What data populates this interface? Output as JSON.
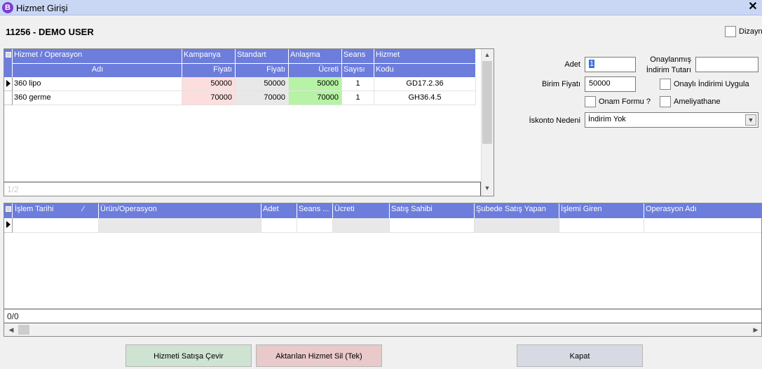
{
  "window": {
    "title": "Hizmet Girişi",
    "app_icon": "B",
    "close_glyph": "✕"
  },
  "customer": {
    "label": "11256  -  DEMO USER"
  },
  "dizayn_label": "Dizayn",
  "services_grid": {
    "headers_top": [
      "Hizmet / Operasyon",
      "Kampanya",
      "Standart",
      "Anlaşma",
      "Seans",
      "Hizmet"
    ],
    "headers_bottom": [
      "Adı",
      "Fiyatı",
      "Fiyatı",
      "Ücreti",
      "Sayısı",
      "Kodu"
    ],
    "rows": [
      {
        "name": "360 lipo",
        "kampanya": "50000",
        "standart": "50000",
        "anlasma": "50000",
        "seans": "1",
        "kod": "GD17.2.36"
      },
      {
        "name": "360 germe",
        "kampanya": "70000",
        "standart": "70000",
        "anlasma": "70000",
        "seans": "1",
        "kod": "GH36.4.5"
      }
    ],
    "footer": "1/2"
  },
  "form": {
    "adet_label": "Adet",
    "adet_value": "1",
    "onaylanmis_label_1": "Onaylanmış",
    "onaylanmis_label_2": "İndirim Tutarı",
    "onaylanmis_value": "",
    "birim_fiyati_label": "Birim Fiyatı",
    "birim_fiyati_value": "50000",
    "onayli_indirimi_label": "Onaylı İndirimi Uygula",
    "onam_formu_label": "Onam Formu ?",
    "ameliyathane_label": "Ameliyathane",
    "iskonto_label": "İskonto Nedeni",
    "iskonto_value": "İndirim Yok"
  },
  "sales_grid": {
    "headers": [
      "İşlem Tarihi",
      "Ürün/Operasyon",
      "Adet",
      "Seans ...",
      "Ücreti",
      "Satış Sahibi",
      "Şubede Satış Yapan",
      "İşlemi Giren",
      "Operasyon Adı"
    ],
    "footer": "0/0"
  },
  "buttons": {
    "convert": "Hizmeti Satışa Çevir",
    "delete": "Aktarılan Hizmet Sil (Tek)",
    "close": "Kapat"
  },
  "colors": {
    "header": "#6d7ddc",
    "kampanya_cell": "#fcdede",
    "standart_cell": "#e8e8e8",
    "anlasma_cell": "#b6f3a4",
    "convert_btn": "#cfe3d3",
    "delete_btn": "#e9c9c9",
    "close_btn": "#d7dae3"
  }
}
